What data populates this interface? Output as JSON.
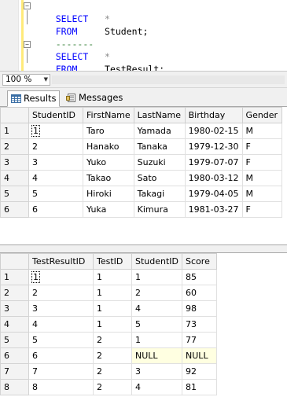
{
  "editor": {
    "lines": [
      {
        "kw": "SELECT",
        "rest": "*"
      },
      {
        "kw": "FROM",
        "rest": "Student;"
      },
      {
        "separator": "-------"
      },
      {
        "kw": "SELECT",
        "rest": "*"
      },
      {
        "kw": "FROM",
        "rest": "TestResult;"
      }
    ]
  },
  "zoom": {
    "value": "100 %"
  },
  "tabs": {
    "results": "Results",
    "messages": "Messages"
  },
  "student_grid": {
    "columns": [
      "StudentID",
      "FirstName",
      "LastName",
      "Birthday",
      "Gender"
    ],
    "rows": [
      [
        "1",
        "1",
        "Taro",
        "Yamada",
        "1980-02-15",
        "M"
      ],
      [
        "2",
        "2",
        "Hanako",
        "Tanaka",
        "1979-12-30",
        "F"
      ],
      [
        "3",
        "3",
        "Yuko",
        "Suzuki",
        "1979-07-07",
        "F"
      ],
      [
        "4",
        "4",
        "Takao",
        "Sato",
        "1980-03-12",
        "M"
      ],
      [
        "5",
        "5",
        "Hiroki",
        "Takagi",
        "1979-04-05",
        "M"
      ],
      [
        "6",
        "6",
        "Yuka",
        "Kimura",
        "1981-03-27",
        "F"
      ]
    ]
  },
  "result_grid": {
    "columns": [
      "TestResultID",
      "TestID",
      "StudentID",
      "Score"
    ],
    "rows": [
      [
        "1",
        "1",
        "1",
        "1",
        "85"
      ],
      [
        "2",
        "2",
        "1",
        "2",
        "60"
      ],
      [
        "3",
        "3",
        "1",
        "4",
        "98"
      ],
      [
        "4",
        "4",
        "1",
        "5",
        "73"
      ],
      [
        "5",
        "5",
        "2",
        "1",
        "77"
      ],
      [
        "6",
        "6",
        "2",
        "NULL",
        "NULL"
      ],
      [
        "7",
        "7",
        "2",
        "3",
        "92"
      ],
      [
        "8",
        "8",
        "2",
        "4",
        "81"
      ]
    ]
  },
  "colors": {
    "keyword": "#0000ff",
    "null_cell": "#ffffe1",
    "change_bar": "#ffea7a"
  }
}
